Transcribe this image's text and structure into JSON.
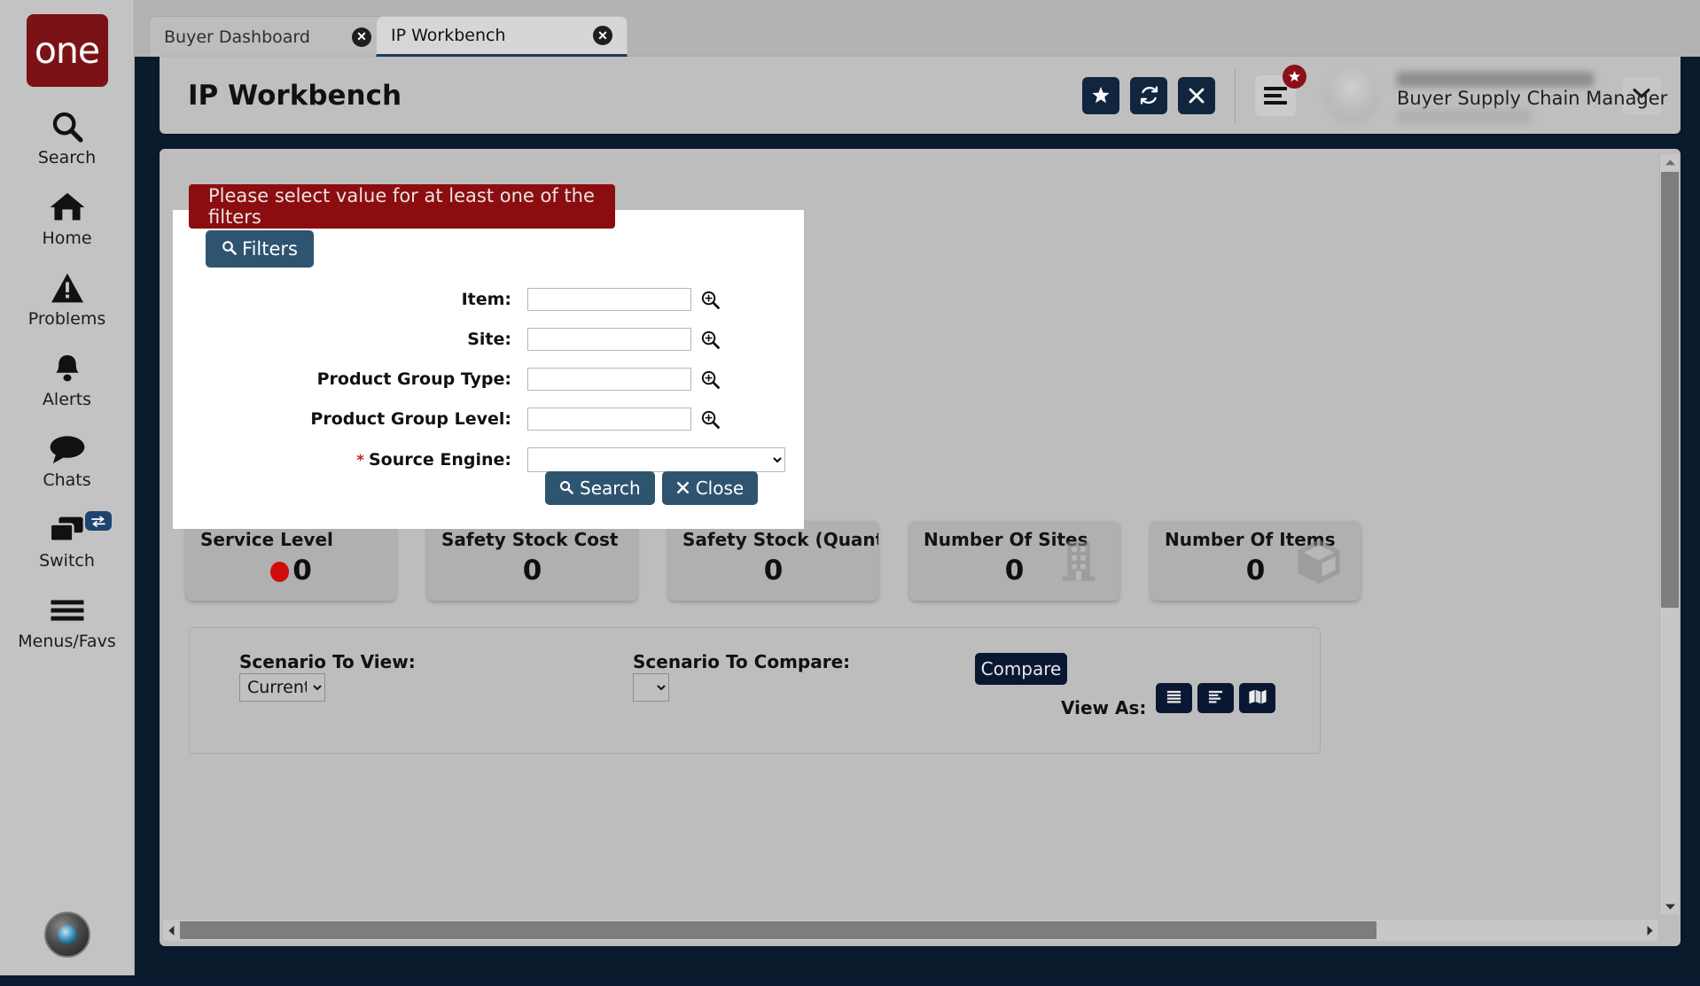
{
  "brand": {
    "logo_text": "one"
  },
  "rail": {
    "items": [
      {
        "label": "Search",
        "icon": "search-icon"
      },
      {
        "label": "Home",
        "icon": "home-icon"
      },
      {
        "label": "Problems",
        "icon": "warning-triangle-icon"
      },
      {
        "label": "Alerts",
        "icon": "bell-icon"
      },
      {
        "label": "Chats",
        "icon": "chat-bubble-icon"
      },
      {
        "label": "Switch",
        "icon": "windows-switch-icon",
        "badge_icon": "exchange-arrows-icon"
      },
      {
        "label": "Menus/Favs",
        "icon": "hamburger-icon"
      }
    ],
    "avatar_icon": "user-avatar-icon"
  },
  "tabs": [
    {
      "label": "Buyer Dashboard",
      "active": false,
      "close_icon": "close-circle-icon"
    },
    {
      "label": "IP Workbench",
      "active": true,
      "close_icon": "close-circle-icon"
    }
  ],
  "header": {
    "title": "IP Workbench",
    "actions": [
      {
        "name": "favorite-button",
        "icon": "star-icon"
      },
      {
        "name": "refresh-button",
        "icon": "refresh-icon"
      },
      {
        "name": "close-button",
        "icon": "x-icon"
      }
    ],
    "menu_icon": "hamburger-menu-icon",
    "menu_badge_icon": "star-badge-icon",
    "profile": {
      "role": "Buyer Supply Chain Manager",
      "caret_icon": "chevron-down-icon",
      "avatar_icon": "user-avatar-icon"
    }
  },
  "error": {
    "message": "Please select value for at least one of the filters"
  },
  "filters": {
    "button_label": "Filters",
    "button_icon": "search-icon",
    "fields": [
      {
        "label": "Item:",
        "value": "",
        "placeholder": "",
        "type": "text",
        "required": false,
        "picker_icon": "magnifier-plus-icon"
      },
      {
        "label": "Site:",
        "value": "",
        "placeholder": "",
        "type": "text",
        "required": false,
        "picker_icon": "magnifier-plus-icon"
      },
      {
        "label": "Product Group Type:",
        "value": "",
        "placeholder": "",
        "type": "text",
        "required": false,
        "picker_icon": "magnifier-plus-icon"
      },
      {
        "label": "Product Group Level:",
        "value": "",
        "placeholder": "",
        "type": "text",
        "required": false,
        "picker_icon": "magnifier-plus-icon"
      },
      {
        "label": "Source Engine:",
        "value": "",
        "placeholder": "",
        "type": "select",
        "required": true,
        "options": [
          ""
        ]
      }
    ],
    "search_label": "Search",
    "search_icon": "search-icon",
    "close_label": "Close",
    "close_icon": "x-icon"
  },
  "kpis": [
    {
      "title": "Service Level",
      "value": "0",
      "status_color": "#d00b0b",
      "has_status_dot": true,
      "glyph": ""
    },
    {
      "title": "Safety Stock Cost",
      "value": "0",
      "has_status_dot": false,
      "glyph": ""
    },
    {
      "title": "Safety Stock (Quantity)",
      "value": "0",
      "has_status_dot": false,
      "glyph": ""
    },
    {
      "title": "Number Of Sites",
      "value": "0",
      "has_status_dot": false,
      "glyph": "building-icon"
    },
    {
      "title": "Number Of Items",
      "value": "0",
      "has_status_dot": false,
      "glyph": "box-icon"
    }
  ],
  "scenario": {
    "view_label": "Scenario To View:",
    "view_value": "Current",
    "view_options": [
      "Current"
    ],
    "compare_label": "Scenario To Compare:",
    "compare_value": "",
    "compare_options": [
      ""
    ],
    "compare_button": "Compare",
    "view_as_label": "View As:",
    "view_as_buttons": [
      {
        "name": "view-as-table-button",
        "icon": "list-full-icon",
        "active": false
      },
      {
        "name": "view-as-detail-button",
        "icon": "list-indent-icon",
        "active": false
      },
      {
        "name": "view-as-map-button",
        "icon": "map-icon",
        "active": true
      }
    ]
  },
  "scrollbars": {
    "vertical": {
      "up_icon": "caret-up-icon",
      "down_icon": "caret-down-icon"
    },
    "horizontal": {
      "left_icon": "caret-left-icon",
      "right_icon": "caret-right-icon"
    }
  },
  "colors": {
    "brand_red": "#7b1215",
    "error_red": "#8c0d10",
    "accent_navy": "#12253f",
    "button_blue": "#2e5470",
    "dark_navy": "#0a1733",
    "status_red": "#d00b0b"
  }
}
